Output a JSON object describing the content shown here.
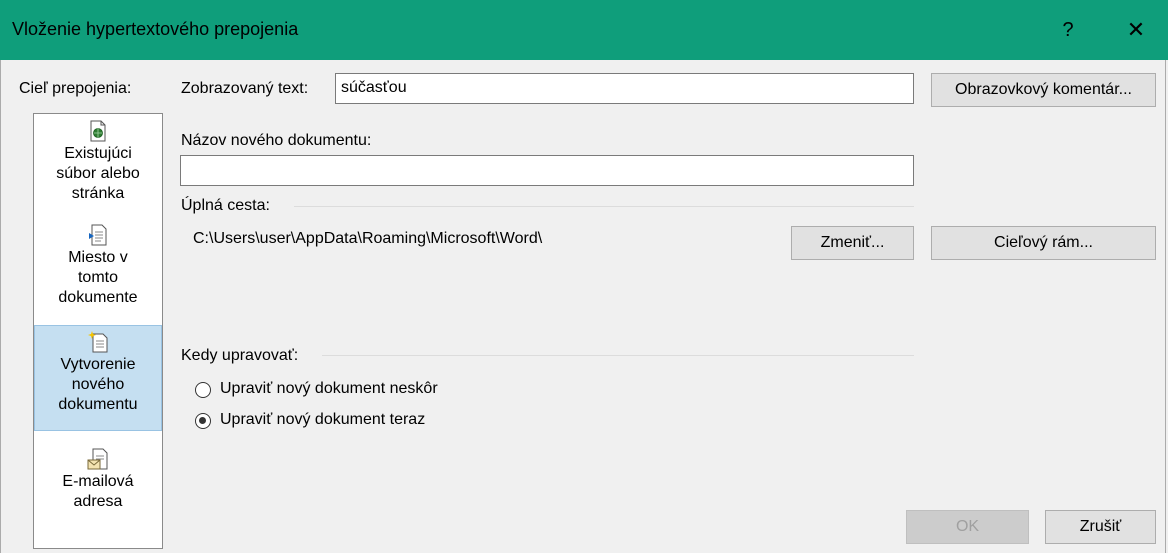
{
  "window": {
    "title": "Vloženie hypertextového prepojenia",
    "help_label": "?",
    "close_label": "✕"
  },
  "left": {
    "heading": "Cieľ prepojenia:",
    "items": [
      {
        "label_lines": [
          "Existujúci",
          "súbor alebo",
          "stránka"
        ],
        "icon": "existing-file-icon",
        "selected": false
      },
      {
        "label_lines": [
          "Miesto v",
          "tomto",
          "dokumente"
        ],
        "icon": "place-in-document-icon",
        "selected": false
      },
      {
        "label_lines": [
          "Vytvorenie",
          "nového",
          "dokumentu"
        ],
        "icon": "new-document-icon",
        "selected": true
      },
      {
        "label_lines": [
          "E-mailová",
          "adresa"
        ],
        "icon": "email-address-icon",
        "selected": false
      }
    ]
  },
  "display_text": {
    "label": "Zobrazovaný text:",
    "value": "súčasťou"
  },
  "screen_tip_button": "Obrazovkový komentár...",
  "new_doc_name": {
    "label": "Názov nového dokumentu:",
    "value": ""
  },
  "full_path": {
    "label": "Úplná cesta:",
    "value": "C:\\Users\\user\\AppData\\Roaming\\Microsoft\\Word\\"
  },
  "change_button": "Zmeniť...",
  "target_frame_button": "Cieľový rám...",
  "when_to_edit": {
    "label": "Kedy upravovať:",
    "options": [
      {
        "label": "Upraviť nový dokument neskôr",
        "checked": false
      },
      {
        "label": "Upraviť nový dokument teraz",
        "checked": true
      }
    ]
  },
  "ok_button": "OK",
  "cancel_button": "Zrušiť"
}
